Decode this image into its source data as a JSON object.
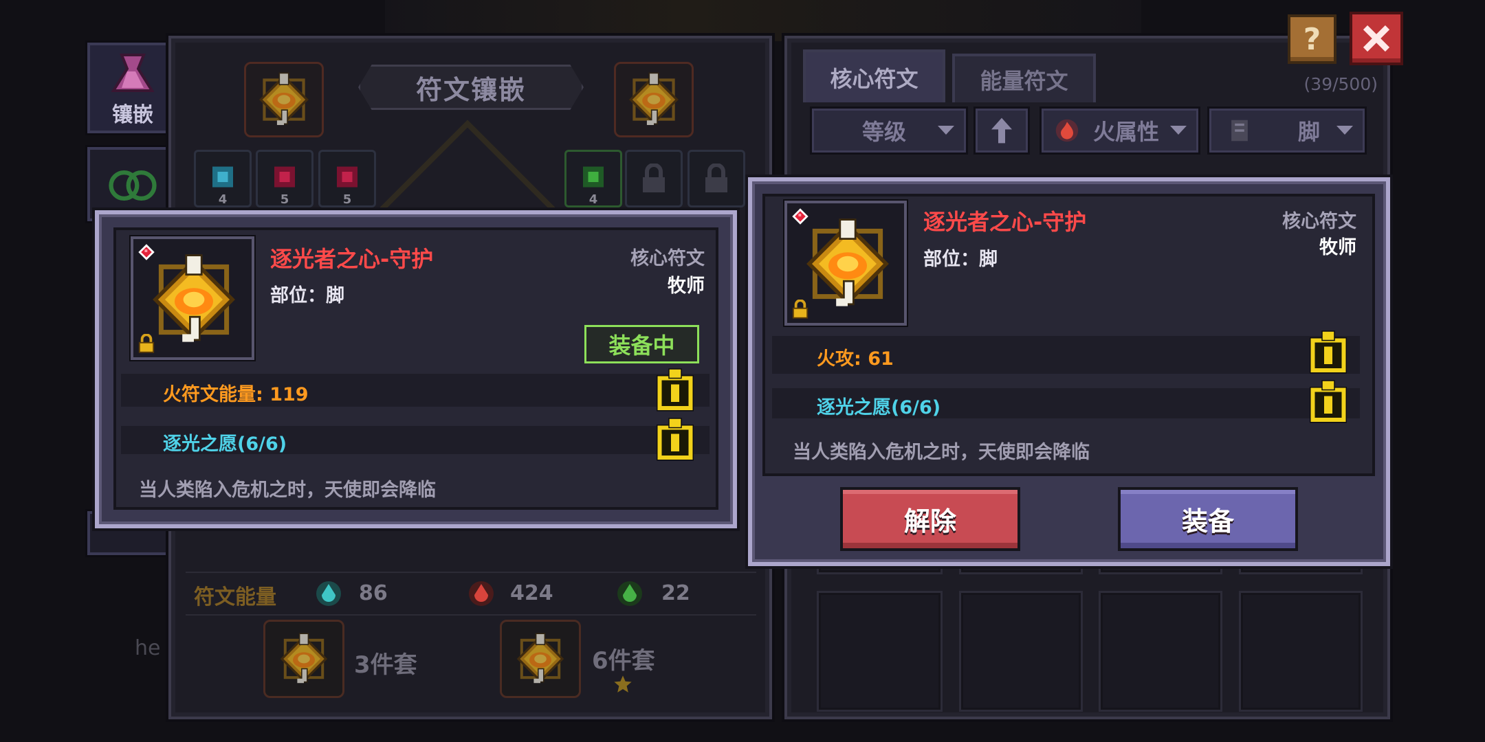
{
  "header": {
    "help_label": "?",
    "close_icon": "close-icon"
  },
  "side_tabs": [
    {
      "label": "镶嵌",
      "icon": "inlay-icon"
    }
  ],
  "stray_text": "he",
  "left_panel": {
    "title": "符文镶嵌",
    "small_slots": [
      {
        "level": "4",
        "color": "#2aa7c9"
      },
      {
        "level": "5",
        "color": "#c2224b"
      },
      {
        "level": "5",
        "color": "#c2224b"
      },
      {
        "level": "4",
        "color": "#3fae3f"
      }
    ],
    "energy_label": "符文能量",
    "energies": [
      {
        "value": "86",
        "color": "#3fc6c6"
      },
      {
        "value": "424",
        "color": "#d8443c"
      },
      {
        "value": "22",
        "color": "#46b046"
      }
    ],
    "sets": [
      {
        "label": "3件套"
      },
      {
        "label": "6件套"
      }
    ]
  },
  "right_panel": {
    "tabs": [
      {
        "label": "核心符文",
        "active": true
      },
      {
        "label": "能量符文",
        "active": false
      }
    ],
    "count": "(39/500)",
    "filters": {
      "level": "等级",
      "element": "火属性",
      "slot": "脚"
    }
  },
  "equipped_card": {
    "name": "逐光者之心-守护",
    "slot": "部位：脚",
    "type": "核心符文",
    "class": "牧师",
    "status": "装备中",
    "stats": [
      {
        "text": "火符文能量: 119",
        "color": "#ff9a1f"
      },
      {
        "text": "逐光之愿(6/6)",
        "color": "#4fd2e8"
      }
    ],
    "description": "当人类陷入危机之时，天使即会降临"
  },
  "selected_card": {
    "name": "逐光者之心-守护",
    "slot": "部位：脚",
    "type": "核心符文",
    "class": "牧师",
    "stats": [
      {
        "text": "火攻: 61",
        "color": "#ff9a1f"
      },
      {
        "text": "逐光之愿(6/6)",
        "color": "#4fd2e8"
      }
    ],
    "description": "当人类陷入危机之时，天使即会降临",
    "buttons": {
      "remove": "解除",
      "equip": "装备"
    }
  },
  "colors": {
    "accent_gold": "#f2d21b",
    "title_red": "#ff4a4a",
    "equipped_green": "#8de05a"
  }
}
